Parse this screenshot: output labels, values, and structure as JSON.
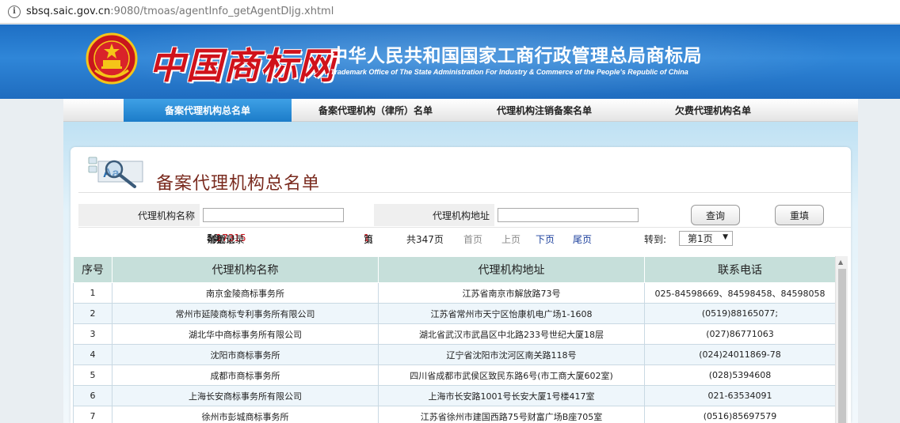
{
  "address_bar": {
    "host": "sbsq.saic.gov.cn",
    "path": ":9080/tmoas/agentInfo_getAgentDljg.xhtml"
  },
  "header": {
    "logo_text": "中国商标网",
    "bureau_cn": "中华人民共和国国家工商行政管理总局商标局",
    "bureau_en": "Trademark Office of The State Administration For Industry & Commerce of the People’s Republic of China"
  },
  "nav": {
    "tabs": [
      {
        "label": "备案代理机构总名单"
      },
      {
        "label": "备案代理机构（律所）名单"
      },
      {
        "label": "代理机构注销备案名单"
      },
      {
        "label": "欠费代理机构名单"
      }
    ]
  },
  "page": {
    "title": "备案代理机构总名单"
  },
  "search": {
    "name_label": "代理机构名称",
    "name_value": "",
    "address_label": "代理机构地址",
    "address_value": "",
    "query_button": "查询",
    "reset_button": "重填"
  },
  "pagination": {
    "per_page_prefix": "每页",
    "per_page": "50",
    "per_page_suffix": "条记录",
    "total_prefix": "共",
    "total_records": "17315",
    "total_suffix": "条记录",
    "current_prefix": "第",
    "current_page": "1",
    "current_suffix": "页",
    "total_pages_text": "共347页",
    "first_label": "首页",
    "prev_label": "上页",
    "next_label": "下页",
    "last_label": "尾页",
    "goto_label": "转到:",
    "goto_selected": "第1页"
  },
  "table": {
    "headers": [
      "序号",
      "代理机构名称",
      "代理机构地址",
      "联系电话"
    ],
    "rows": [
      [
        "1",
        "南京金陵商标事务所",
        "江苏省南京市解放路73号",
        "025-84598669、84598458、84598058"
      ],
      [
        "2",
        "常州市延陵商标专利事务所有限公司",
        "江苏省常州市天宁区怡康机电广场1-1608",
        "(0519)88165077;"
      ],
      [
        "3",
        "湖北华中商标事务所有限公司",
        "湖北省武汉市武昌区中北路233号世纪大厦18层",
        "(027)86771063"
      ],
      [
        "4",
        "沈阳市商标事务所",
        "辽宁省沈阳市沈河区南关路118号",
        "(024)24011869-78"
      ],
      [
        "5",
        "成都市商标事务所",
        "四川省成都市武侯区致民东路6号(市工商大厦602室)",
        "(028)5394608"
      ],
      [
        "6",
        "上海长安商标事务所有限公司",
        "上海市长安路1001号长安大厦1号楼417室",
        "021-63534091"
      ],
      [
        "7",
        "徐州市彭城商标事务所",
        "江苏省徐州市建国西路75号财富广场B座705室",
        "(0516)85697579"
      ]
    ]
  }
}
